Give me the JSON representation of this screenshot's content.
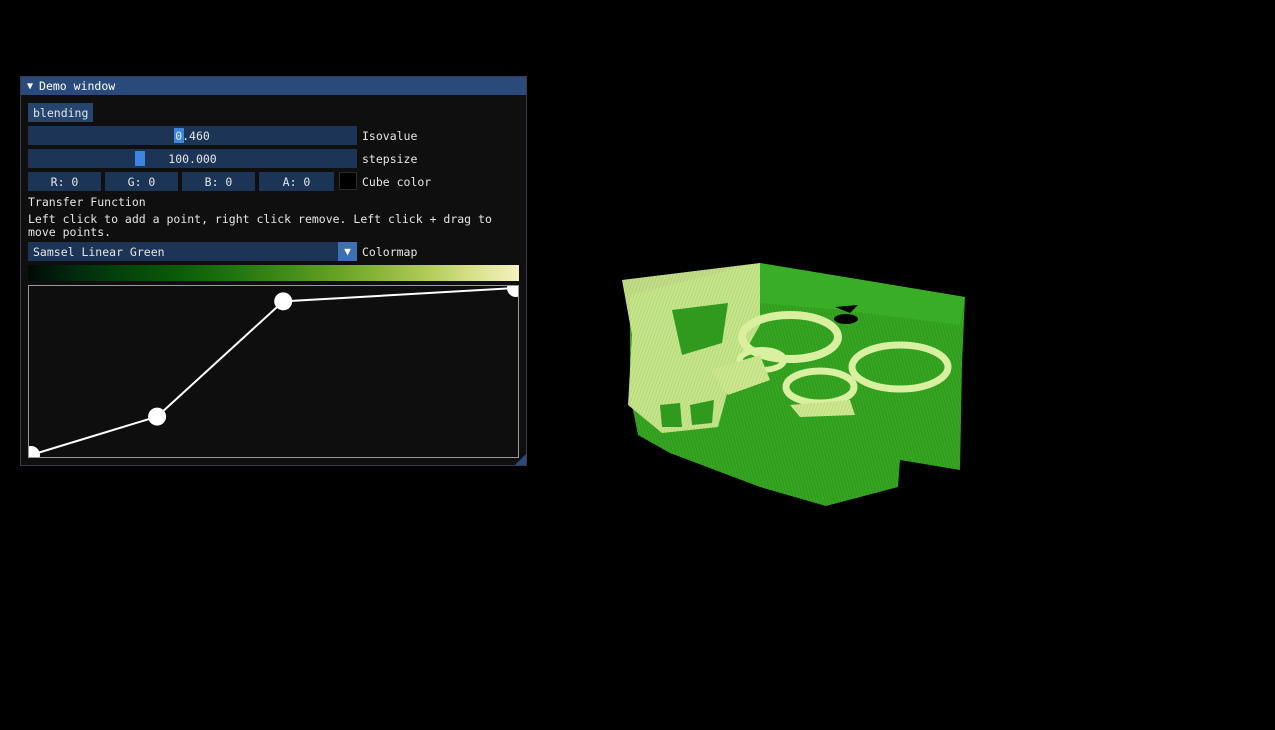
{
  "window": {
    "title": "Demo window",
    "collapse_icon": "triangle-down-icon"
  },
  "blending_button": "blending",
  "isovalue": {
    "value": "0.460",
    "label": "Isovalue",
    "fraction": 0.46
  },
  "stepsize": {
    "value": "100.000",
    "label": "stepsize",
    "fraction": 0.34
  },
  "cube_color": {
    "r": "R:  0",
    "g": "G:  0",
    "b": "B:  0",
    "a": "A:  0",
    "label": "Cube color",
    "swatch": "#000000"
  },
  "transfer_function": {
    "title": "Transfer Function",
    "help_line1": "Left click to add a point, right click remove. Left click + drag to",
    "help_line2": "move points.",
    "points": [
      [
        0.0,
        0.0
      ],
      [
        0.26,
        0.23
      ],
      [
        0.52,
        0.92
      ],
      [
        1.0,
        1.0
      ]
    ]
  },
  "colormap": {
    "selected": "Samsel Linear Green",
    "label": "Colormap"
  },
  "colors": {
    "title_bar": "#294a7a",
    "frame": "#1c3557",
    "accent": "#3d85e0",
    "volume_green": "#2f9a1e",
    "volume_highlight": "#d9f0a0"
  }
}
